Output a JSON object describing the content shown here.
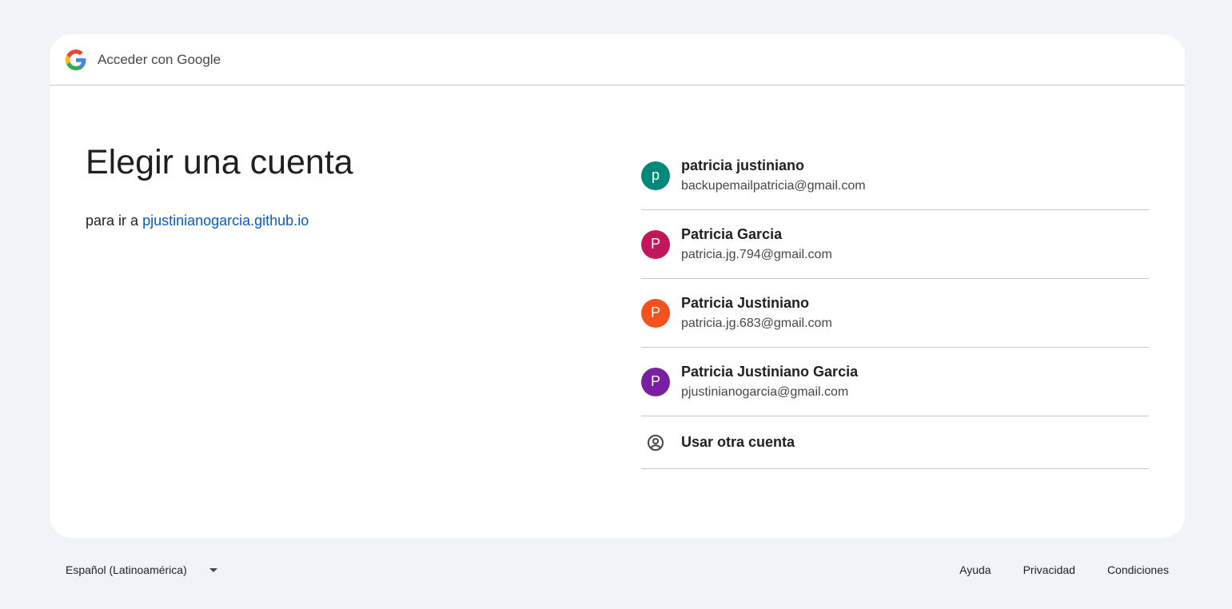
{
  "header": {
    "title": "Acceder con Google",
    "logo": "google-g-logo"
  },
  "main": {
    "title": "Elegir una cuenta",
    "subtitle_prefix": "para ir a",
    "subtitle_link": "pjustinianogarcia.github.io"
  },
  "accounts": [
    {
      "initial": "p",
      "name": "patricia justiniano",
      "email": "backupemailpatricia@gmail.com",
      "color": "#00897b"
    },
    {
      "initial": "P",
      "name": "Patricia Garcia",
      "email": "patricia.jg.794@gmail.com",
      "color": "#c2185b"
    },
    {
      "initial": "P",
      "name": "Patricia Justiniano",
      "email": "patricia.jg.683@gmail.com",
      "color": "#f4511e"
    },
    {
      "initial": "P",
      "name": "Patricia Justiniano Garcia",
      "email": "pjustinianogarcia@gmail.com",
      "color": "#7b1fa2"
    }
  ],
  "other_account": {
    "label": "Usar otra cuenta",
    "icon": "account-circle-icon"
  },
  "footer": {
    "language": "Español (Latinoamérica)",
    "help": "Ayuda",
    "privacy": "Privacidad",
    "terms": "Condiciones"
  }
}
